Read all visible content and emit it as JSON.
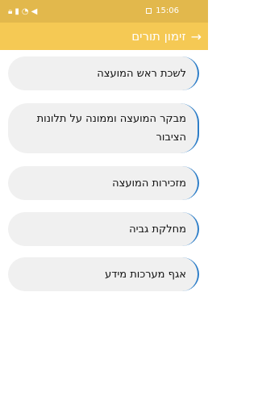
{
  "status_bar": {
    "time": "15:06",
    "left_icons": [
      "lock-icon",
      "signal-icon",
      "wifi-icon",
      "mute-icon"
    ],
    "gallery_icon": "image-icon"
  },
  "app_bar": {
    "title": "זימון תורים",
    "back_icon": "→"
  },
  "items": [
    {
      "label": "לשכת ראש המועצה"
    },
    {
      "label": "מבקר המועצה וממונה על תלונות הציבור"
    },
    {
      "label": "מזכירות המועצה"
    },
    {
      "label": "מחלקת גביה"
    },
    {
      "label": "אגף מערכות מידע"
    }
  ],
  "colors": {
    "status_bar": "#e2b84c",
    "app_bar": "#f5c954",
    "card_bg": "#f0f0f0",
    "card_accent": "#2e7ec8"
  }
}
